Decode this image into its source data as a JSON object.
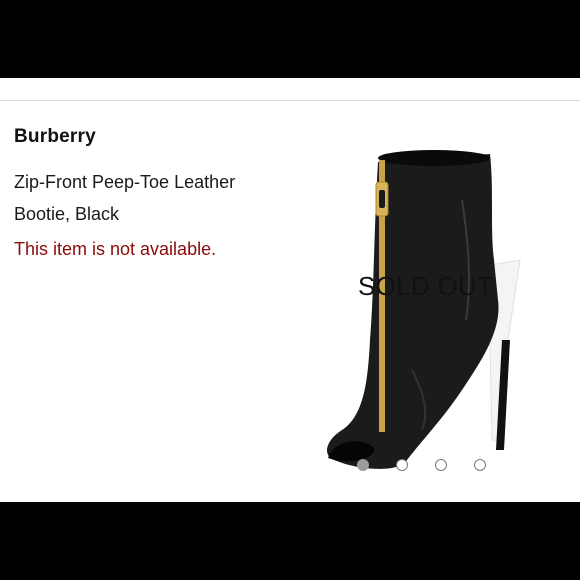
{
  "product": {
    "brand": "Burberry",
    "name_line1": "Zip-Front Peep-Toe Leather",
    "name_line2": "Bootie, Black",
    "availability": "This item is not available."
  },
  "image": {
    "overlay_label": "SOLD OUT",
    "icon": "ankle-bootie-image"
  },
  "carousel": {
    "total_pages": 4,
    "active_page": 1
  },
  "colors": {
    "availability_text": "#8b0a0a",
    "background": "#ffffff",
    "frame": "#000000"
  }
}
